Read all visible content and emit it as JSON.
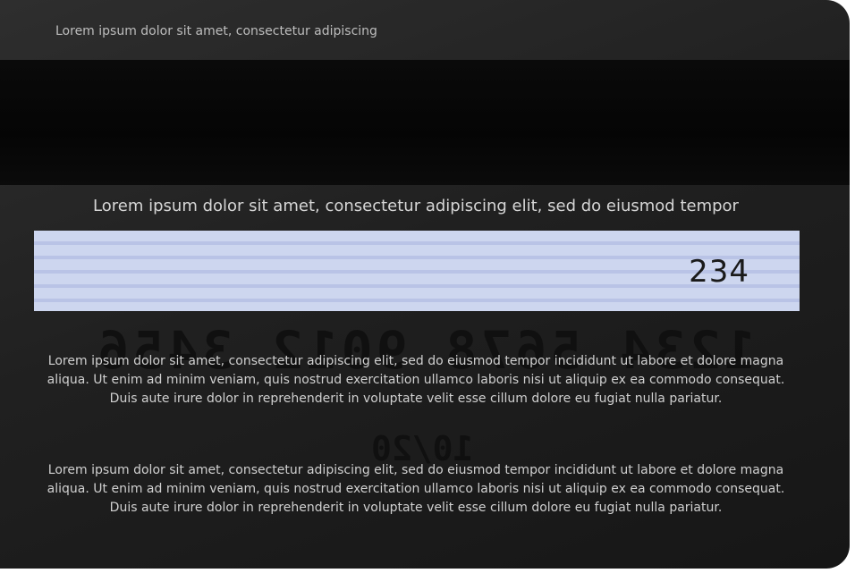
{
  "card_back": {
    "top_text": "Lorem ipsum dolor sit amet, consectetur adipiscing",
    "signature_caption": "Lorem ipsum dolor sit amet, consectetur adipiscing elit, sed do eiusmod tempor",
    "cvv": "234",
    "embossed_number_mirrored": "1234 5678 9012 3456",
    "embossed_expiry_mirrored": "10/20",
    "paragraph_1": "Lorem ipsum dolor sit amet, consectetur adipiscing elit, sed do eiusmod tempor incididunt ut labore et dolore magna aliqua. Ut enim ad minim veniam, quis nostrud exercitation ullamco laboris nisi ut aliquip ex ea commodo consequat. Duis aute irure dolor in reprehenderit in voluptate velit esse cillum dolore eu fugiat nulla pariatur.",
    "paragraph_2": "Lorem ipsum dolor sit amet, consectetur adipiscing elit, sed do eiusmod tempor incididunt ut labore et dolore magna aliqua. Ut enim ad minim veniam, quis nostrud exercitation ullamco laboris nisi ut aliquip ex ea commodo consequat. Duis aute irure dolor in reprehenderit in voluptate velit esse cillum dolore eu fugiat nulla pariatur."
  },
  "colors": {
    "card_background": "#202020",
    "magnetic_stripe": "#050505",
    "signature_panel": "#cdd6ef",
    "text": "#d0d0d0"
  }
}
